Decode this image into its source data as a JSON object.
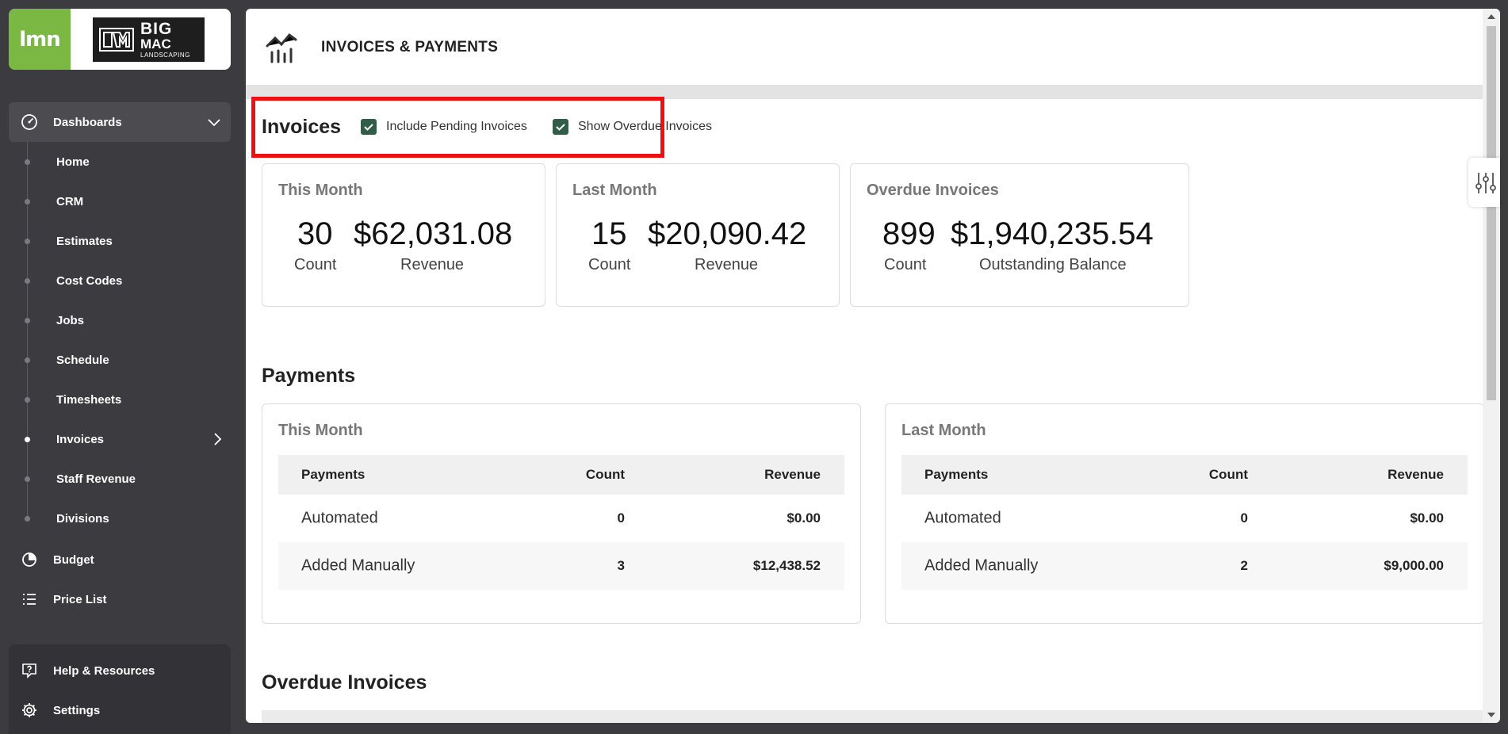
{
  "brand": {
    "lmn_logo": "lmn",
    "company_logo_line1": "BIG",
    "company_logo_line2": "MAC",
    "company_logo_line3": "LANDSCAPING",
    "lmn_green": "#7ab843"
  },
  "sidebar": {
    "dashboards_label": "Dashboards",
    "subitems": [
      {
        "label": "Home"
      },
      {
        "label": "CRM"
      },
      {
        "label": "Estimates"
      },
      {
        "label": "Cost Codes"
      },
      {
        "label": "Jobs"
      },
      {
        "label": "Schedule"
      },
      {
        "label": "Timesheets"
      },
      {
        "label": "Invoices",
        "active": true
      },
      {
        "label": "Staff Revenue"
      },
      {
        "label": "Divisions"
      }
    ],
    "budget_label": "Budget",
    "price_list_label": "Price List",
    "help_label": "Help & Resources",
    "settings_label": "Settings"
  },
  "header": {
    "title": "INVOICES & PAYMENTS",
    "icon": "chart-trend-icon"
  },
  "invoices": {
    "section_title": "Invoices",
    "include_pending_label": "Include Pending Invoices",
    "include_pending_checked": true,
    "show_overdue_label": "Show Overdue Invoices",
    "show_overdue_checked": true,
    "highlight_color": "#ee1111",
    "cards": [
      {
        "title": "This Month",
        "count": "30",
        "count_label": "Count",
        "amount": "$62,031.08",
        "amount_label": "Revenue"
      },
      {
        "title": "Last Month",
        "count": "15",
        "count_label": "Count",
        "amount": "$20,090.42",
        "amount_label": "Revenue"
      },
      {
        "title": "Overdue Invoices",
        "count": "899",
        "count_label": "Count",
        "amount": "$1,940,235.54",
        "amount_label": "Outstanding Balance"
      }
    ]
  },
  "payments": {
    "section_title": "Payments",
    "columns": [
      "Payments",
      "Count",
      "Revenue"
    ],
    "this_month": {
      "title": "This Month",
      "rows": [
        {
          "name": "Automated",
          "count": "0",
          "revenue": "$0.00"
        },
        {
          "name": "Added Manually",
          "count": "3",
          "revenue": "$12,438.52"
        }
      ]
    },
    "last_month": {
      "title": "Last Month",
      "rows": [
        {
          "name": "Automated",
          "count": "0",
          "revenue": "$0.00"
        },
        {
          "name": "Added Manually",
          "count": "2",
          "revenue": "$9,000.00"
        }
      ]
    }
  },
  "overdue": {
    "section_title": "Overdue Invoices"
  },
  "colors": {
    "checkbox": "#2f5d4a",
    "sidebar_bg": "#3c3c40"
  }
}
